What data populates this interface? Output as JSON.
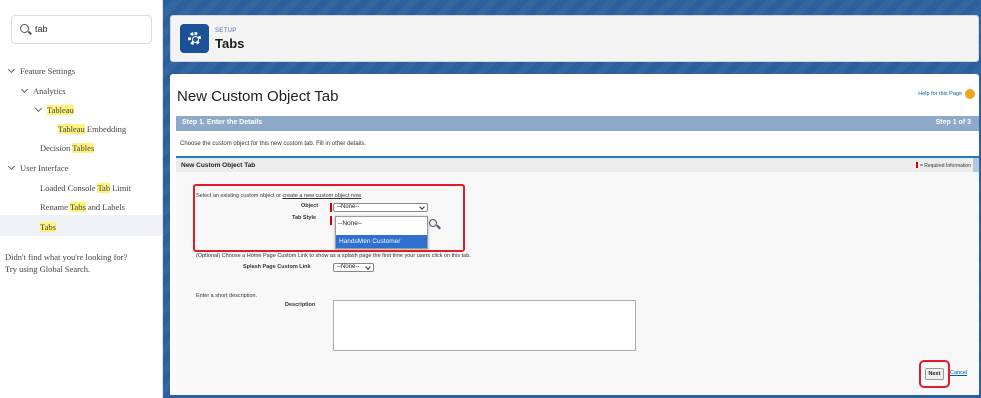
{
  "sidebar": {
    "search_value": "tab",
    "feature_settings": "Feature Settings",
    "analytics": "Analytics",
    "tableau": "Tableau",
    "tableau_embedding_hl": "Tableau",
    "tableau_embedding_rest": " Embedding",
    "decision_pre": "Decision ",
    "decision_hl": "Tables",
    "user_interface": "User Interface",
    "loaded_pre": "Loaded Console ",
    "loaded_hl": "Tab",
    "loaded_post": " Limit",
    "rename_pre": "Rename ",
    "rename_hl": "Tabs",
    "rename_post": " and Labels",
    "tabs_hl": "Tabs",
    "help_line1": "Didn't find what you're looking for?",
    "help_line2": "Try using Global Search."
  },
  "header": {
    "setup": "SETUP",
    "title": "Tabs"
  },
  "main": {
    "title": "New Custom Object Tab",
    "help_link": "Help for this Page",
    "step_label": "Step 1. Enter the Details",
    "step_count": "Step 1 of 3",
    "instructions": "Choose the custom object for this new custom tab. Fill in other details.",
    "section_title": "New Custom Object Tab",
    "required_info": "= Required Information",
    "select_existing": "Select an existing custom object or ",
    "create_link": "create a new custom object now",
    "object_label": "Object",
    "object_value": "--None--",
    "tab_style_label": "Tab Style",
    "tab_style_value": "--None--",
    "dropdown_option_none": "--None--",
    "dropdown_option_selected": "HandsMen Customer",
    "optional_text": "(Optional) Choose a Home Page Custom Link to show as a splash page the first time your users click on this tab.",
    "splash_label": "Splash Page Custom Link",
    "splash_value": "--None--",
    "short_desc": "Enter a short description.",
    "description_label": "Description",
    "next_label": "Next",
    "cancel_label": "Cancel"
  },
  "colors": {
    "band": "#2b5f9e",
    "step_bar": "#8ea9c8",
    "selected_option": "#2f6fd0",
    "annotation_red": "#e01e2b",
    "highlight_yellow": "#fff27a"
  }
}
